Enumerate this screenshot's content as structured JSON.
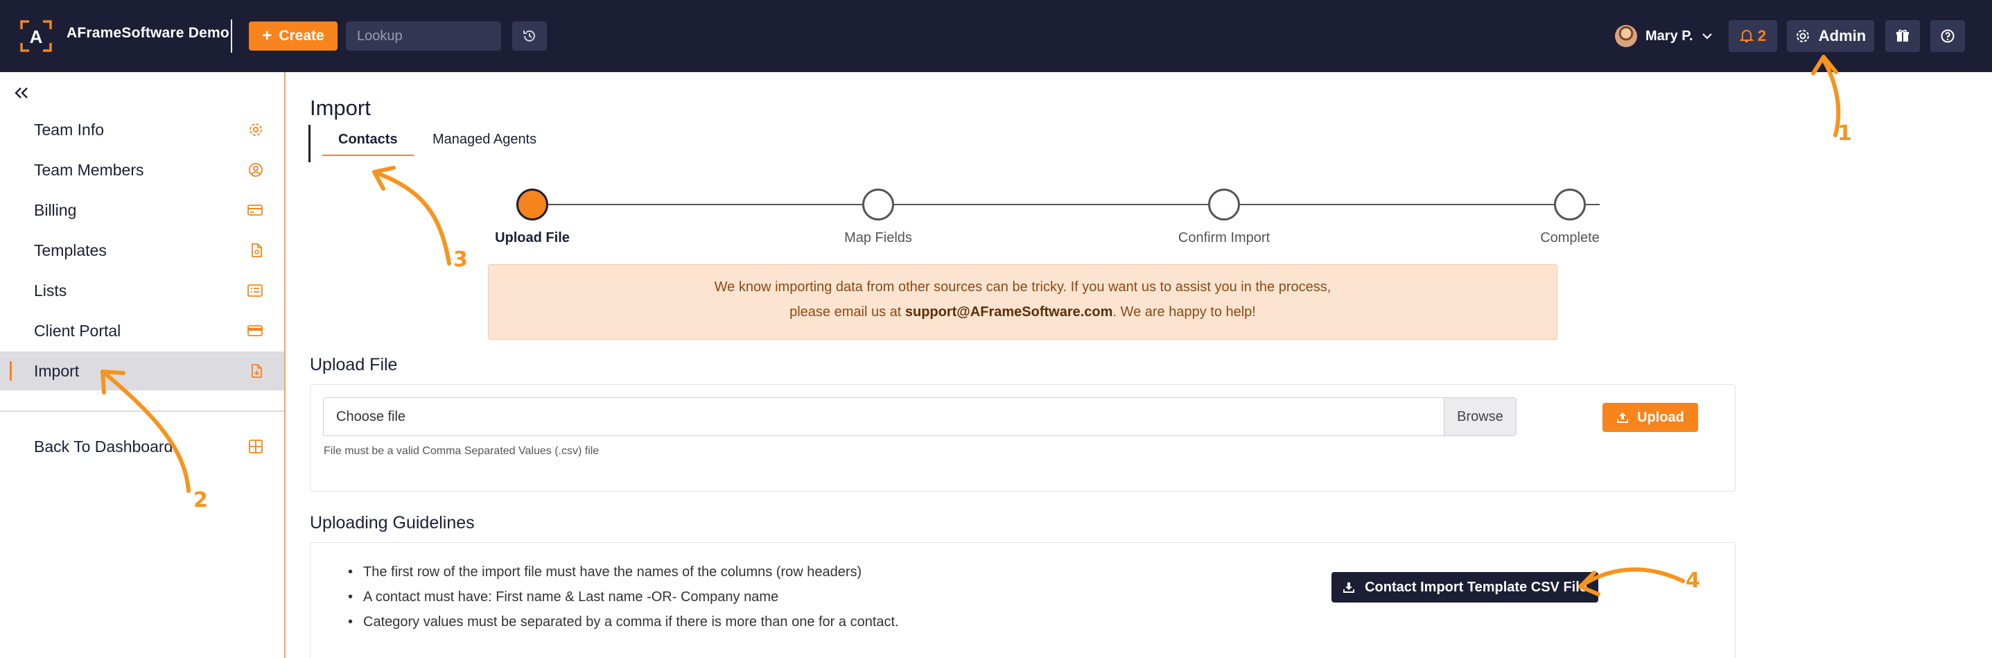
{
  "header": {
    "app_title": "AFrameSoftware Demo",
    "create_label": "Create",
    "lookup_placeholder": "Lookup",
    "user_name": "Mary P.",
    "notification_count": "2",
    "admin_label": "Admin"
  },
  "sidebar": {
    "items": [
      {
        "label": "Team Info",
        "icon": "gear-icon"
      },
      {
        "label": "Team Members",
        "icon": "user-circle-icon"
      },
      {
        "label": "Billing",
        "icon": "credit-card-icon"
      },
      {
        "label": "Templates",
        "icon": "file-icon"
      },
      {
        "label": "Lists",
        "icon": "list-icon"
      },
      {
        "label": "Client Portal",
        "icon": "card-icon"
      },
      {
        "label": "Import",
        "icon": "file-import-icon",
        "active": true
      }
    ],
    "back_label": "Back To Dashboard"
  },
  "main": {
    "title": "Import",
    "tabs": [
      {
        "label": "Contacts",
        "active": true
      },
      {
        "label": "Managed Agents",
        "active": false
      }
    ],
    "steps": [
      {
        "label": "Upload File",
        "active": true
      },
      {
        "label": "Map Fields",
        "active": false
      },
      {
        "label": "Confirm Import",
        "active": false
      },
      {
        "label": "Complete",
        "active": false
      }
    ],
    "notice": {
      "line1": "We know importing data from other sources can be tricky. If you want us to assist you in the process,",
      "line2_prefix": "please email us at ",
      "email": "support@AFrameSoftware.com",
      "line2_suffix": ". We are happy to help!"
    },
    "upload": {
      "section_title": "Upload File",
      "file_placeholder": "Choose file",
      "browse_label": "Browse",
      "upload_label": "Upload",
      "help_text": "File must be a valid Comma Separated Values (.csv) file"
    },
    "guidelines": {
      "section_title": "Uploading Guidelines",
      "items": [
        "The first row of the import file must have the names of the columns (row headers)",
        "A contact must have: First name & Last name -OR- Company name",
        "Category values must be separated by a comma if there is more than one for a contact."
      ],
      "template_button_label": "Contact Import Template CSV File"
    }
  },
  "annotations": [
    "1",
    "2",
    "3",
    "4"
  ],
  "colors": {
    "accent": "#f7841d",
    "navy": "#1c1e35",
    "notice_bg": "#fde4d1",
    "annotation": "#f7941d"
  }
}
